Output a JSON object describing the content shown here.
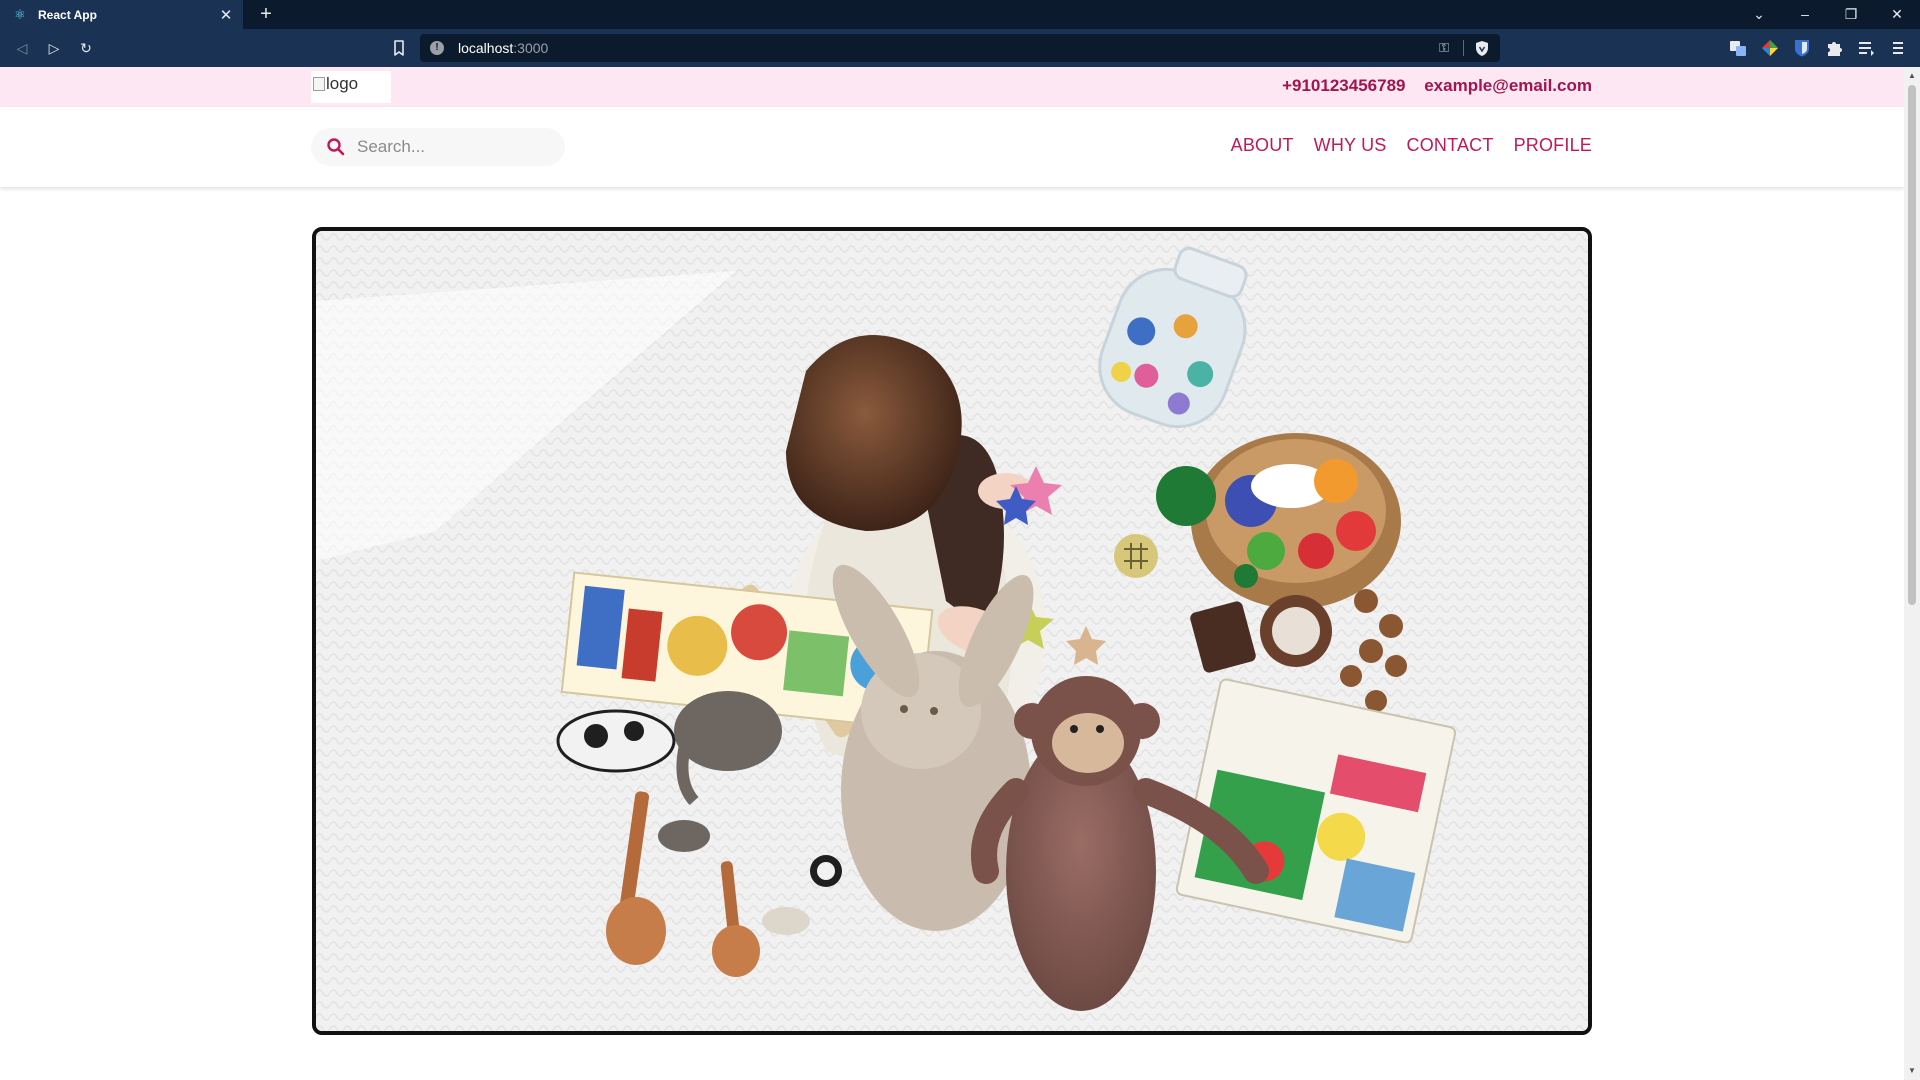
{
  "browser": {
    "tab_title": "React App",
    "url_host": "localhost",
    "url_port": ":3000"
  },
  "icons": {
    "tab_favicon": "react-icon",
    "tab_close": "close-icon",
    "new_tab": "plus-icon",
    "back": "back-icon",
    "forward": "forward-icon",
    "reload": "reload-icon",
    "bookmark": "bookmark-icon",
    "site_info": "info-icon",
    "password_key": "key-icon",
    "brave_shield": "shield-icon",
    "search": "search-icon"
  },
  "header": {
    "logo_alt": "logo",
    "phone": "+910123456789",
    "email": "example@email.com"
  },
  "navbar": {
    "search_placeholder": "Search...",
    "links": [
      "ABOUT",
      "WHY US",
      "CONTACT",
      "PROFILE"
    ]
  },
  "colors": {
    "topbar_bg": "#fde7f3",
    "accent": "#c2185b",
    "browser_chrome": "#1a3354"
  }
}
